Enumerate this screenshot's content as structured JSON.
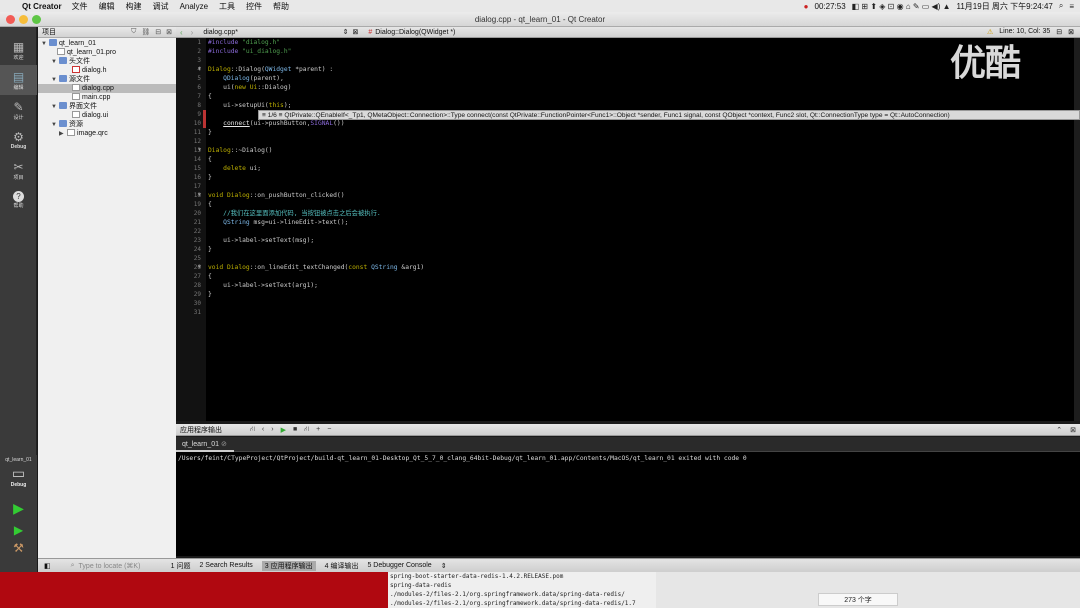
{
  "menubar": {
    "app": "Qt Creator",
    "items": [
      "文件",
      "编辑",
      "构建",
      "调试",
      "Analyze",
      "工具",
      "控件",
      "帮助"
    ],
    "clock": "00:27:53",
    "datetime": "11月19日 周六 下午9:24:47"
  },
  "window_title": "dialog.cpp - qt_learn_01 - Qt Creator",
  "modes": [
    {
      "label": "欢迎",
      "icon": "grid-icon"
    },
    {
      "label": "编辑",
      "icon": "edit-icon"
    },
    {
      "label": "设计",
      "icon": "pen-icon"
    },
    {
      "label": "Debug",
      "icon": "bug-icon"
    },
    {
      "label": "项目",
      "icon": "wrench-icon"
    },
    {
      "label": "帮助",
      "icon": "help-icon"
    }
  ],
  "project_panel": {
    "title": "项目",
    "tree": [
      {
        "label": "qt_learn_01",
        "level": 0,
        "kind": "root"
      },
      {
        "label": "qt_learn_01.pro",
        "level": 1,
        "kind": "file"
      },
      {
        "label": "头文件",
        "level": 1,
        "kind": "folder"
      },
      {
        "label": "dialog.h",
        "level": 2,
        "kind": "header"
      },
      {
        "label": "源文件",
        "level": 1,
        "kind": "folder"
      },
      {
        "label": "dialog.cpp",
        "level": 2,
        "kind": "file",
        "selected": true
      },
      {
        "label": "main.cpp",
        "level": 2,
        "kind": "file"
      },
      {
        "label": "界面文件",
        "level": 1,
        "kind": "folder"
      },
      {
        "label": "dialog.ui",
        "level": 2,
        "kind": "file"
      },
      {
        "label": "资源",
        "level": 1,
        "kind": "folder"
      },
      {
        "label": "image.qrc",
        "level": 2,
        "kind": "file"
      }
    ]
  },
  "editor": {
    "document": "dialog.cpp*",
    "symbol": "Dialog::Dialog(QWidget *)",
    "position": "Line: 10, Col: 35",
    "lines": [
      "#include \"dialog.h\"",
      "#include \"ui_dialog.h\"",
      "",
      "Dialog::Dialog(QWidget *parent) :",
      "    QDialog(parent),",
      "    ui(new Ui::Dialog)",
      "{",
      "    ui->setupUi(this);",
      "",
      "    connect(ui->pushButton,SIGNAL())",
      "}",
      "",
      "Dialog::~Dialog()",
      "{",
      "    delete ui;",
      "}",
      "",
      "void Dialog::on_pushButton_clicked()",
      "{",
      "    //我们在这里面添加代码, 当按钮被点击之后会被执行.",
      "    QString msg=ui->lineEdit->text();",
      "",
      "    ui->label->setText(msg);",
      "}",
      "",
      "void Dialog::on_lineEdit_textChanged(const QString &arg1)",
      "{",
      "    ui->label->setText(arg1);",
      "}",
      "",
      ""
    ],
    "tooltip": "≡ 1/6 ≡  QtPrivate::QEnableIf<_Tp1, QMetaObject::Connection>::Type connect(const QtPrivate::FunctionPointer<Func1>::Object *sender, Func1 signal, const QObject *context, Func2 slot, Qt::ConnectionType type = Qt::AutoConnection)"
  },
  "output": {
    "title": "应用程序输出",
    "tab": "qt_learn_01",
    "text": "/Users/feint/CTypeProject/QtProject/build-qt_learn_01-Desktop_Qt_5_7_0_clang_64bit-Debug/qt_learn_01.app/Contents/MacOS/qt_learn_01 exited with code 0"
  },
  "statusbar": {
    "locator_placeholder": "Type to locate (⌘K)",
    "panes": [
      "1 问题",
      "2 Search Results",
      "3 应用程序输出",
      "4 编译输出",
      "5 Debugger Console"
    ]
  },
  "target": {
    "project": "qt_learn_01",
    "mode": "Debug"
  },
  "terminal_lines": [
    "spring-boot-starter-data-redis-1.4.2.RELEASE.pom",
    "spring-data-redis",
    "./modules-2/files-2.1/org.springframework.data/spring-data-redis/",
    "./modules-2/files-2.1/org.springframework.data/spring-data-redis/1.7",
    "./modules-2/files-2.1/org.springframework.data/spring-data-redis/1.7"
  ],
  "desk_badge": "273 个字",
  "watermark": "优酷"
}
